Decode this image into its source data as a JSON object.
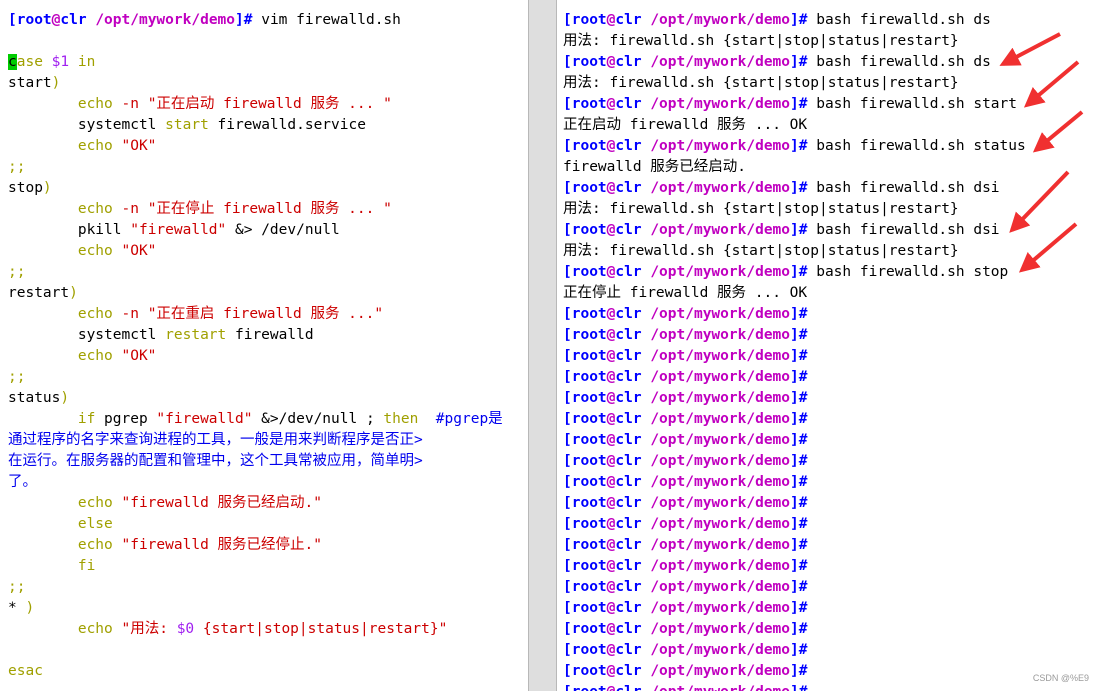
{
  "left": {
    "prompt_user": "root",
    "prompt_at": "@",
    "prompt_host": "clr",
    "prompt_path": "/opt/mywork/demo",
    "prompt_close": "]#",
    "command": " vim firewalld.sh",
    "l_case_c": "c",
    "l_case_rest": "ase",
    "l_case_var": " $1 ",
    "l_case_in": "in",
    "l_start": "start",
    "l_paren": ")",
    "l_echo": "echo",
    "l_dash_n": " -n ",
    "l_start_msg": "\"正在启动 firewalld 服务 ... \"",
    "l_systemctl": "systemctl ",
    "l_start_word": "start",
    "l_firewalld_service": " firewalld.service",
    "l_ok": " \"OK\"",
    "l_semis": ";;",
    "l_stop": "stop",
    "l_stop_msg": "\"正在停止 firewalld 服务 ... \"",
    "l_pkill": "pkill ",
    "l_pkill_arg": "\"firewalld\"",
    "l_redirect": " &> ",
    "l_devnull": "/dev/null",
    "l_restart": "restart",
    "l_restart_msg": "\"正在重启 firewalld 服务 ...\"",
    "l_restart_word": "restart",
    "l_firewalld": " firewalld",
    "l_status": "status",
    "l_if": "if",
    "l_pgrep": " pgrep ",
    "l_pgrep_arg": "\"firewalld\"",
    "l_amp": " &",
    "l_devnull2": ">/dev/null ; ",
    "l_then": "then",
    "l_comment1": "  #pgrep是",
    "l_comment2": "通过程序的名字来查询进程的工具，一般是用来判断程序是否正>",
    "l_comment3": "在运行。在服务器的配置和管理中，这个工具常被应用，简单明>",
    "l_comment4": "了。",
    "l_echo_started": " \"firewalld 服务已经启动.\"",
    "l_else": "else",
    "l_echo_stopped": " \"firewalld 服务已经停止.\"",
    "l_fi": "fi",
    "l_star": "* ",
    "l_usage_open": " \"用法: ",
    "l_usage_var": "$0",
    "l_usage_close": " {start|stop|status|restart}\"",
    "l_esac": "esac"
  },
  "right": {
    "prompt_user": "root",
    "prompt_at": "@",
    "prompt_host": "clr",
    "prompt_path": "/opt/mywork/demo",
    "prompt_close": "]#",
    "usage": "用法: firewalld.sh {start|stop|status|restart}",
    "cmd_ds": " bash firewalld.sh ds",
    "cmd_start": " bash firewalld.sh start",
    "out_start": "正在启动 firewalld 服务 ... OK",
    "cmd_status": " bash firewalld.sh status",
    "out_status": "firewalld 服务已经启动.",
    "cmd_dsi": " bash firewalld.sh dsi",
    "cmd_stop": " bash firewalld.sh stop",
    "out_stop": "正在停止 firewalld 服务 ... OK"
  },
  "watermark": "CSDN @%E9",
  "colors": {
    "prompt_blue": "#0000ff",
    "prompt_magenta": "#c000c0",
    "keyword_yellow": "#a0a000",
    "string_red": "#cc0000",
    "comment_blue": "#0000ee",
    "arrow_red": "#f03030"
  }
}
